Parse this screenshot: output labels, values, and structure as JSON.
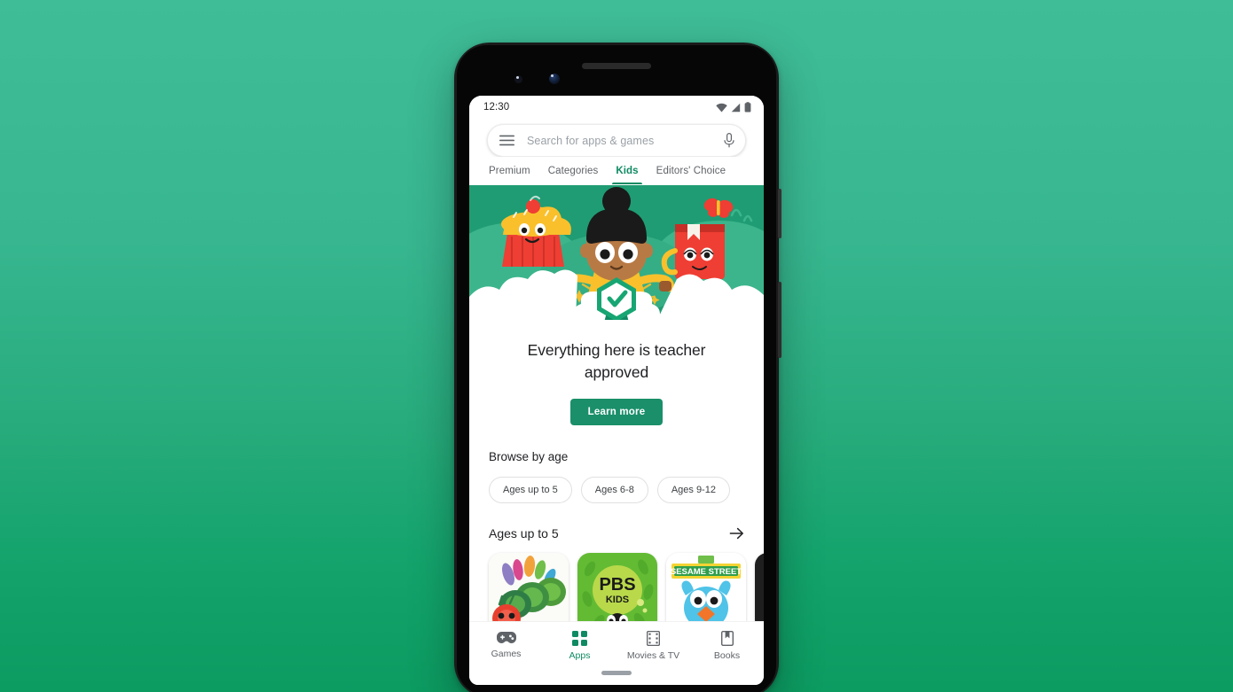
{
  "theme": {
    "background_gradient_top": "#3fbd97",
    "background_gradient_bottom": "#0c9b61",
    "accent_green": "#0f8a63",
    "button_green": "#1a8f6a",
    "hero_green": "#1f9c73"
  },
  "phone": {
    "device_frame": "black smartphone",
    "home_indicator": "gesture-pill"
  },
  "status_bar": {
    "clock": "12:30",
    "icons": [
      "wifi-icon",
      "cell-signal-icon",
      "battery-icon"
    ]
  },
  "search": {
    "placeholder": "Search for apps & games",
    "menu_icon": "hamburger-menu-icon",
    "voice_icon": "microphone-icon"
  },
  "tabs": [
    {
      "label": "Premium",
      "active": false
    },
    {
      "label": "Categories",
      "active": false
    },
    {
      "label": "Kids",
      "active": true
    },
    {
      "label": "Editors' Choice",
      "active": false
    }
  ],
  "hero": {
    "alt": "Illustration of a child with cupcake and book characters above a teacher approved badge",
    "badge": "teacher-approved-check-badge",
    "headline": "Everything here is teacher approved",
    "cta_label": "Learn more"
  },
  "browse_by_age": {
    "title": "Browse by age",
    "chips": [
      "Ages up to 5",
      "Ages 6-8",
      "Ages 9-12"
    ]
  },
  "section": {
    "title": "Ages up to 5",
    "arrow_icon": "arrow-right-icon",
    "apps": [
      {
        "name": "The Very Hungry Caterpillar",
        "tile": "caterpillar"
      },
      {
        "name": "PBS KIDS",
        "tile": "pbs-kids",
        "logo_line1": "PBS",
        "logo_line2": "KIDS"
      },
      {
        "name": "Sesame Street",
        "tile": "sesame-street",
        "logo_text": "SESAME STREET"
      },
      {
        "name": "",
        "tile": "partial"
      }
    ]
  },
  "bottom_nav": [
    {
      "label": "Games",
      "icon": "gamepad-icon",
      "active": false
    },
    {
      "label": "Apps",
      "icon": "grid-apps-icon",
      "active": true
    },
    {
      "label": "Movies & TV",
      "icon": "film-strip-icon",
      "active": false
    },
    {
      "label": "Books",
      "icon": "bookmark-icon",
      "active": false
    }
  ]
}
